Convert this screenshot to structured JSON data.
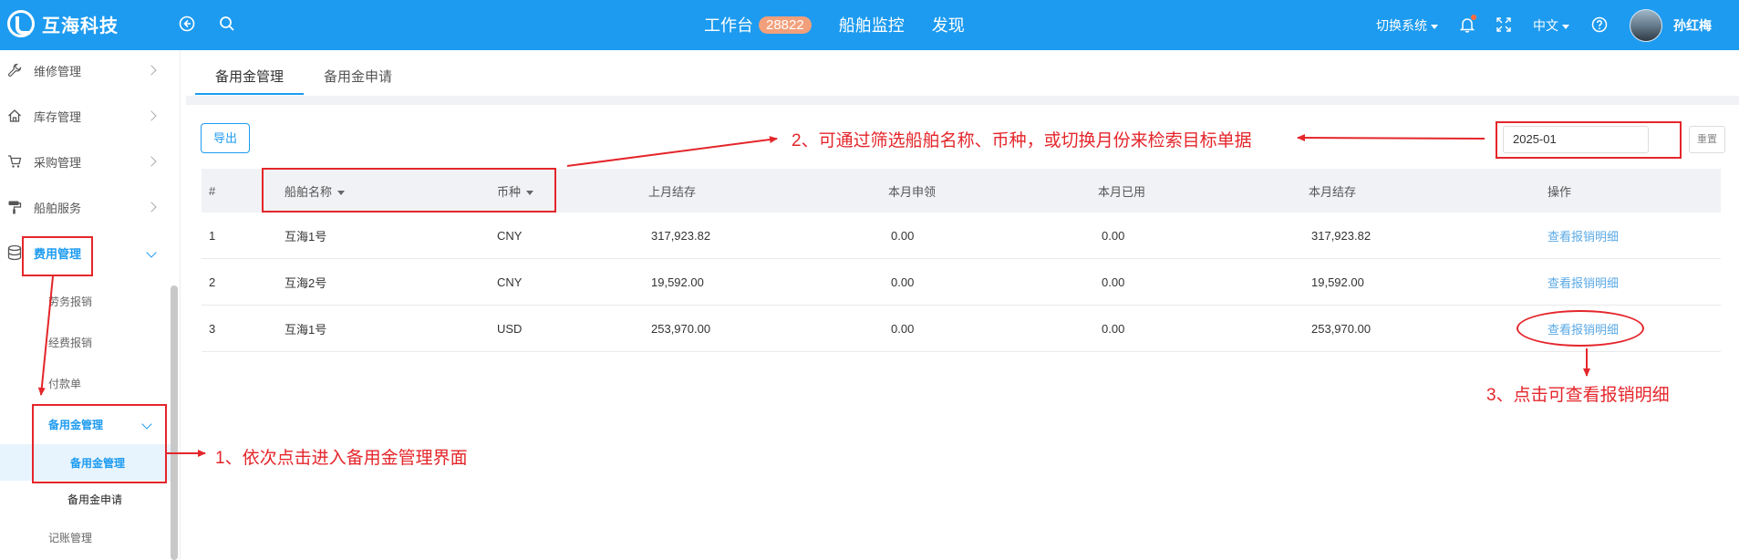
{
  "header": {
    "logo_text": "互海科技",
    "nav": [
      {
        "label": "工作台",
        "badge": "28822"
      },
      {
        "label": "船舶监控"
      },
      {
        "label": "发现"
      }
    ],
    "switch_system": "切换系统",
    "language": "中文",
    "user_name": "孙红梅",
    "brand_color": "#1d9bf0"
  },
  "sidebar": {
    "items": [
      {
        "label": "维修管理",
        "icon": "wrench-icon"
      },
      {
        "label": "库存管理",
        "icon": "home-icon"
      },
      {
        "label": "采购管理",
        "icon": "cart-icon"
      },
      {
        "label": "船舶服务",
        "icon": "paint-roller-icon"
      },
      {
        "label": "费用管理",
        "icon": "database-icon"
      }
    ],
    "sub_items": [
      "劳务报销",
      "经费报销",
      "付款单"
    ],
    "group": {
      "label": "备用金管理",
      "children": [
        "备用金管理",
        "备用金申请"
      ]
    },
    "last_item": "记账管理"
  },
  "tabs": [
    "备用金管理",
    "备用金申请"
  ],
  "toolbar": {
    "export_label": "导出",
    "month_value": "2025-01",
    "reset_label": "重置"
  },
  "table": {
    "headers": [
      "#",
      "船舶名称",
      "币种",
      "上月结存",
      "本月申领",
      "本月已用",
      "本月结存",
      "操作"
    ],
    "rows": [
      {
        "no": "1",
        "ship": "互海1号",
        "currency": "CNY",
        "prev": "317,923.82",
        "apply": "0.00",
        "used": "0.00",
        "balance": "317,923.82",
        "action": "查看报销明细"
      },
      {
        "no": "2",
        "ship": "互海2号",
        "currency": "CNY",
        "prev": "19,592.00",
        "apply": "0.00",
        "used": "0.00",
        "balance": "19,592.00",
        "action": "查看报销明细"
      },
      {
        "no": "3",
        "ship": "互海1号",
        "currency": "USD",
        "prev": "253,970.00",
        "apply": "0.00",
        "used": "0.00",
        "balance": "253,970.00",
        "action": "查看报销明细"
      }
    ]
  },
  "annotations": {
    "step1": "1、依次点击进入备用金管理界面",
    "step2": "2、可通过筛选船舶名称、币种，或切换月份来检索目标单据",
    "step3": "3、点击可查看报销明细",
    "color": "#e4262b"
  }
}
